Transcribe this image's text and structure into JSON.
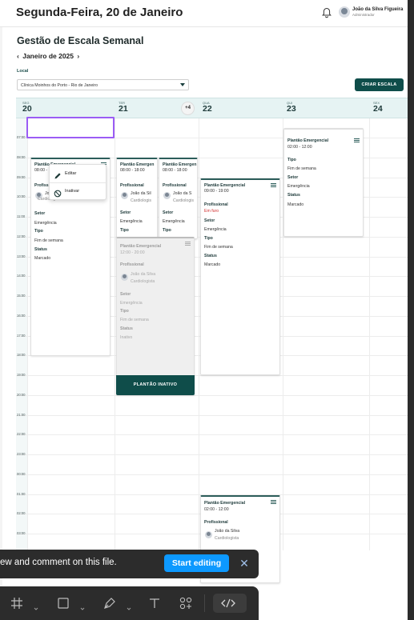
{
  "header": {
    "date_title": "Segunda-Feira, 20 de Janeiro",
    "user_name": "João da Silva Figueira",
    "user_role": "Administrador"
  },
  "page": {
    "title": "Gestão de Escala Semanal",
    "month_label": "Janeiro de 2025",
    "prev_glyph": "‹",
    "next_glyph": "›",
    "local_label": "Local",
    "local_value": "Clínica Moinhos do Porto - Rio de Janeiro",
    "create_button": "CRIAR ESCALA"
  },
  "days": [
    {
      "abbr": "SEG",
      "num": "20"
    },
    {
      "abbr": "TER",
      "num": "21"
    },
    {
      "abbr": "QUA",
      "num": "22"
    },
    {
      "abbr": "QUI",
      "num": "23"
    },
    {
      "abbr": "SEX",
      "num": "24"
    }
  ],
  "more_badge": "+4",
  "hours": [
    "07:00",
    "08:00",
    "09:00",
    "10:00",
    "11:00",
    "12:00",
    "13:00",
    "14:00",
    "15:00",
    "16:00",
    "17:00",
    "18:00",
    "19:00",
    "20:00",
    "21:00",
    "22:00",
    "23:00",
    "00:00",
    "01:00",
    "02:00",
    "03:00"
  ],
  "labels": {
    "profissional": "Profissional",
    "setor": "Setor",
    "tipo": "Tipo",
    "status": "Status"
  },
  "cards": {
    "c1": {
      "title": "Plantão Emergencial",
      "time": "08:00 - 18:00",
      "prof_partial": "Profiss",
      "name_partial": "Jo",
      "spec": "Cardiologista",
      "setor": "Emergência",
      "tipo": "Fim de semana",
      "status": "Marcado"
    },
    "c2": {
      "title": "Plantão Emergen",
      "time": "08:00 - 18:00",
      "prof": "Profissional",
      "name": "João da Sil",
      "spec": "Cardiologis",
      "setor": "Emergência",
      "tipo": "Tipo"
    },
    "c3": {
      "title": "Plantão Emergen",
      "time": "08:00 - 18:00",
      "prof": "Profissional",
      "name": "João da S",
      "spec": "Cardiologis",
      "setor": "Emergência",
      "tipo": "Tipo"
    },
    "c4": {
      "title": "Plantão Emergencial",
      "time": "12:00 - 20:00",
      "prof": "Profissional",
      "name": "João da Silva",
      "spec": "Cardiologista",
      "setor": "Emergência",
      "tipo": "Fim de semana",
      "status": "Inativo",
      "button": "PLANTÃO INATIVO"
    },
    "c5": {
      "title": "Plantão Emergencial",
      "time": "09:00 - 19:00",
      "prof": "Profissional",
      "prof_status": "Em furo",
      "setor": "Emergência",
      "tipo": "Fim de semana",
      "status": "Marcado"
    },
    "c6": {
      "title": "Plantão Emergencial",
      "time": "02:00 - 12:00",
      "setor": "Emergência",
      "tipo": "Fim de semana",
      "status": "Marcado"
    },
    "c7": {
      "title": "Plantão Emergencial",
      "time": "02:00 - 12:00",
      "prof": "Profissional",
      "name": "João da Silva",
      "spec": "Cardiologista",
      "tipo_partial": "Fim de semana"
    }
  },
  "context_menu": {
    "edit": "Editar",
    "deactivate": "Inativar"
  },
  "banner": {
    "text": "ew and comment on this file.",
    "button": "Start editing",
    "close": "✕"
  },
  "toolbar": {
    "tools": [
      "frame-tool",
      "shape-tool",
      "pen-tool",
      "text-tool",
      "components-tool",
      "dev-mode-toggle"
    ]
  }
}
